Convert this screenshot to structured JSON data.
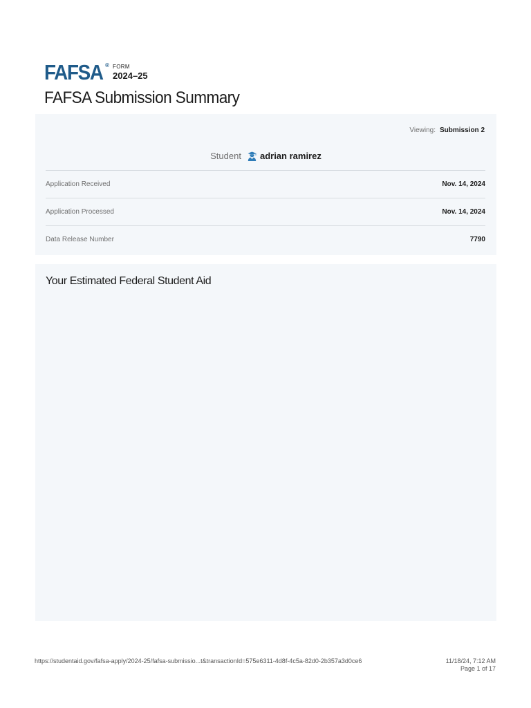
{
  "header": {
    "logo_text": "FAFSA",
    "logo_registered": "®",
    "form_label": "FORM",
    "form_year": "2024–25",
    "page_title": "FAFSA Submission Summary"
  },
  "summary": {
    "viewing_label": "Viewing:",
    "viewing_value": "Submission 2",
    "student_label": "Student",
    "student_icon": "graduate-icon",
    "student_name": "adrian ramirez",
    "rows": [
      {
        "label": "Application Received",
        "value": "Nov. 14, 2024"
      },
      {
        "label": "Application Processed",
        "value": "Nov. 14, 2024"
      },
      {
        "label": "Data Release Number",
        "value": "7790"
      }
    ]
  },
  "aid_section": {
    "title": "Your Estimated Federal Student Aid"
  },
  "footer": {
    "url": "https://studentaid.gov/fafsa-apply/2024-25/fafsa-submissio...t&transactionId=575e6311-4d8f-4c5a-82d0-2b357a3d0ce6",
    "timestamp": "11/18/24, 7:12 AM",
    "page_indicator": "Page 1 of 17"
  },
  "colors": {
    "brand": "#1f5b8a",
    "card_background": "#f4f7fa",
    "icon_blue": "#2e7cb8"
  }
}
